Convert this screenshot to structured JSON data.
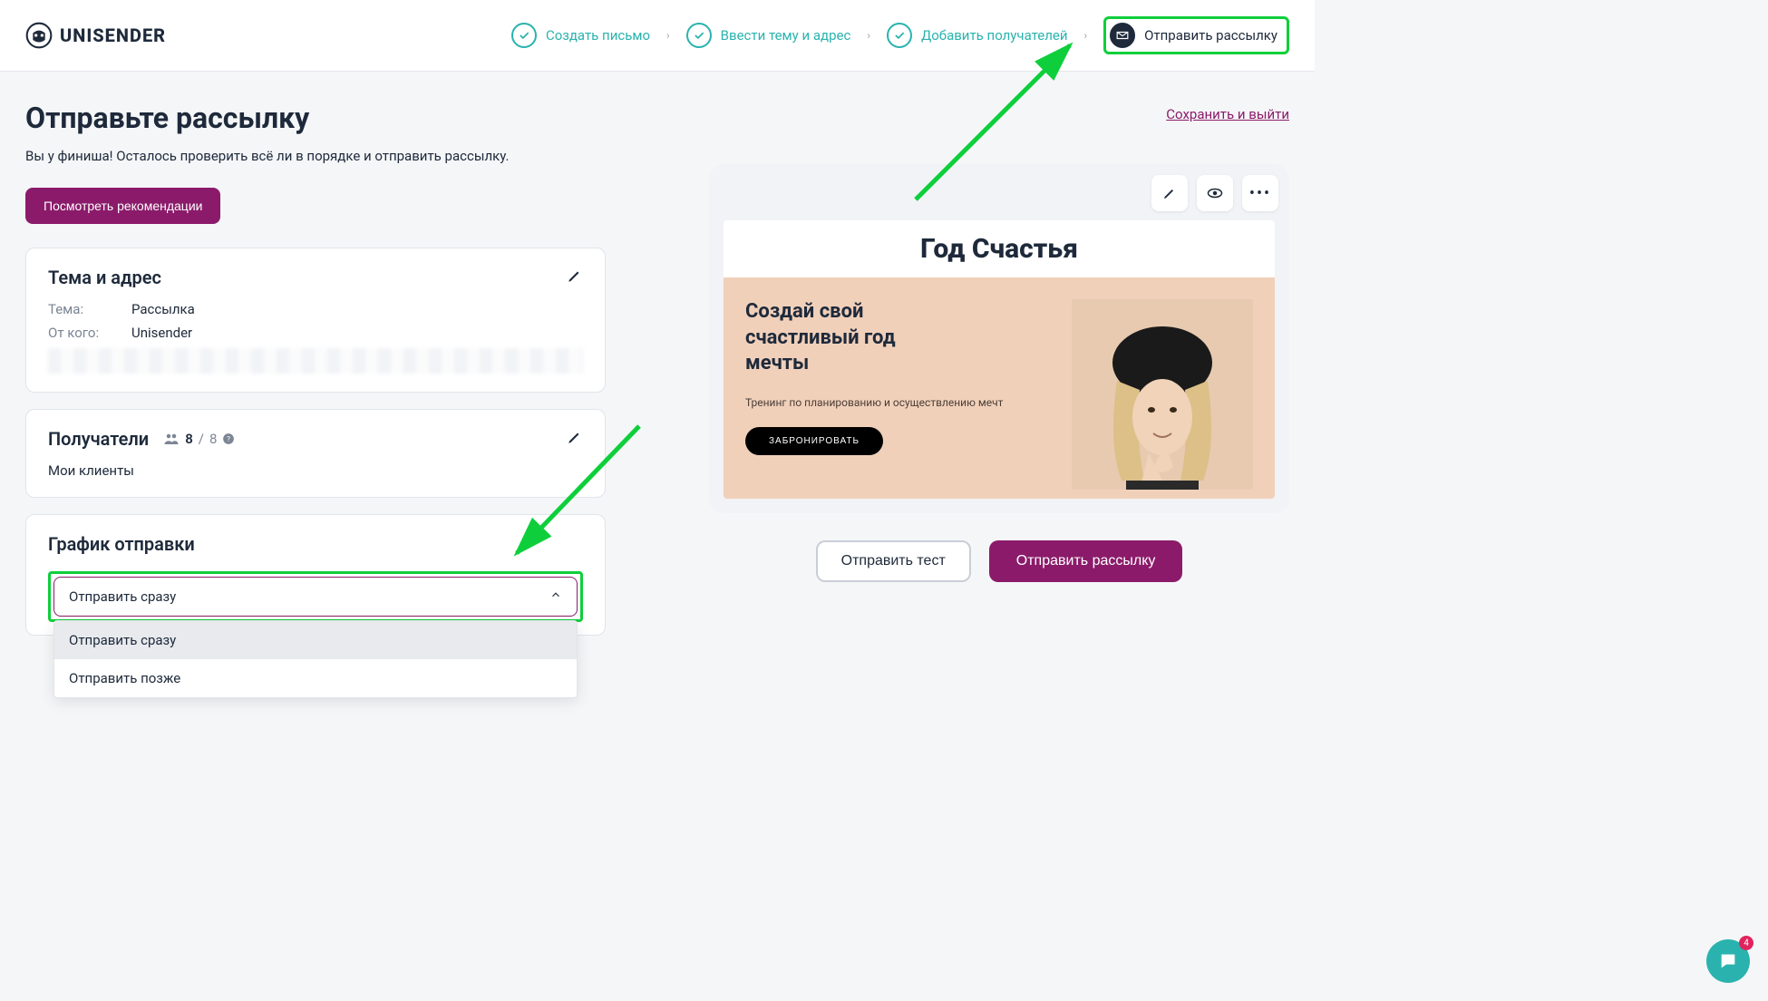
{
  "logo": "UNISENDER",
  "steps": {
    "s1": "Создать письмо",
    "s2": "Ввести тему и адрес",
    "s3": "Добавить получателей",
    "s4": "Отправить рассылку"
  },
  "title": "Отправьте рассылку",
  "subtitle": "Вы у финиша! Осталось проверить всё ли в порядке и отправить рассылку.",
  "saveExit": "Сохранить и выйти",
  "reco": "Посмотреть рекомендации",
  "subjectCard": {
    "title": "Тема и адрес",
    "subjectLabel": "Тема:",
    "subjectValue": "Рассылка",
    "fromLabel": "От кого:",
    "fromValue": "Unisender"
  },
  "recipCard": {
    "title": "Получатели",
    "count": "8",
    "total": "8",
    "list": "Мои клиенты"
  },
  "scheduleCard": {
    "title": "График отправки",
    "selected": "Отправить сразу",
    "opt1": "Отправить сразу",
    "opt2": "Отправить позже"
  },
  "preview": {
    "heading": "Год Счастья",
    "line1": "Создай свой",
    "line2": "счастливый год",
    "line3": "мечты",
    "sub": "Тренинг по планированию и осуществлению мечт",
    "cta": "ЗАБРОНИРОВАТЬ"
  },
  "actions": {
    "test": "Отправить тест",
    "send": "Отправить рассылку"
  },
  "chatBadge": "4"
}
